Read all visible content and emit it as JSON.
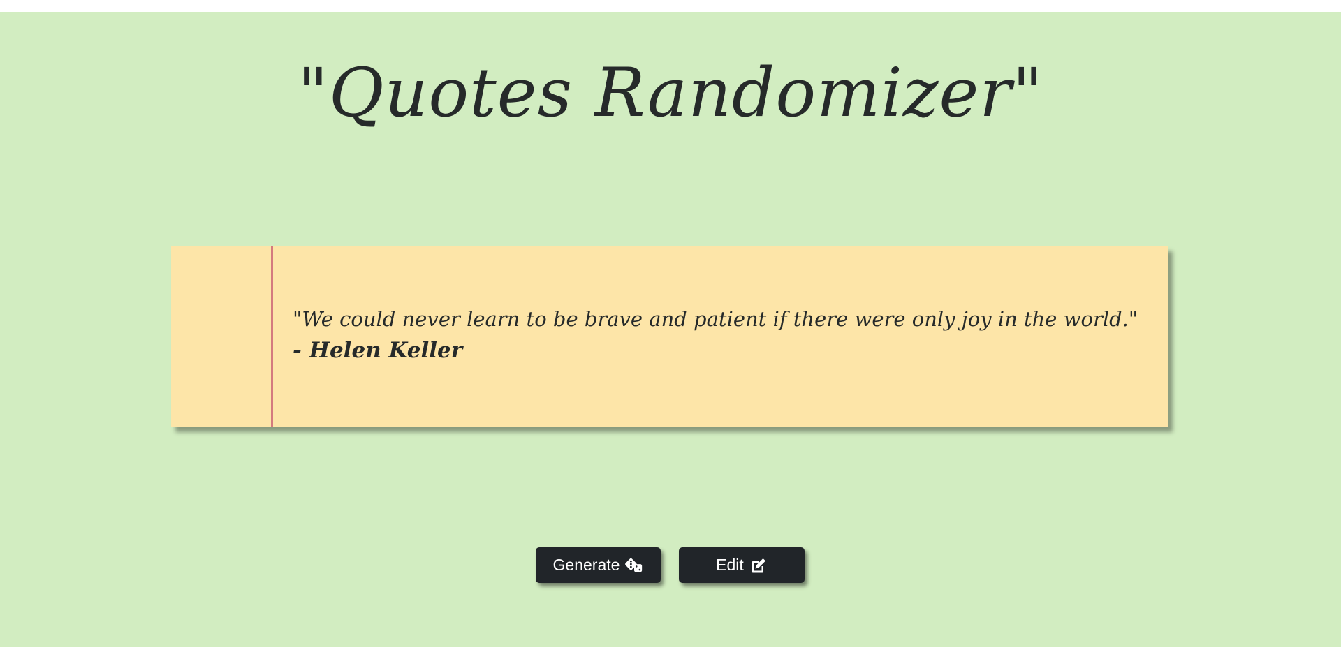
{
  "header": {
    "title": "\"Quotes Randomizer\""
  },
  "quote": {
    "text": "\"We could never learn to be brave and patient if there were only joy in the world.\"",
    "author": "- Helen Keller"
  },
  "actions": {
    "generate_label": "Generate",
    "generate_icon": "dice-icon",
    "edit_label": "Edit",
    "edit_icon": "edit-icon"
  },
  "colors": {
    "background": "#d2edc1",
    "note": "#fde5a8",
    "margin_line": "#d47a7e",
    "button": "#212529",
    "text": "#262a2a"
  }
}
